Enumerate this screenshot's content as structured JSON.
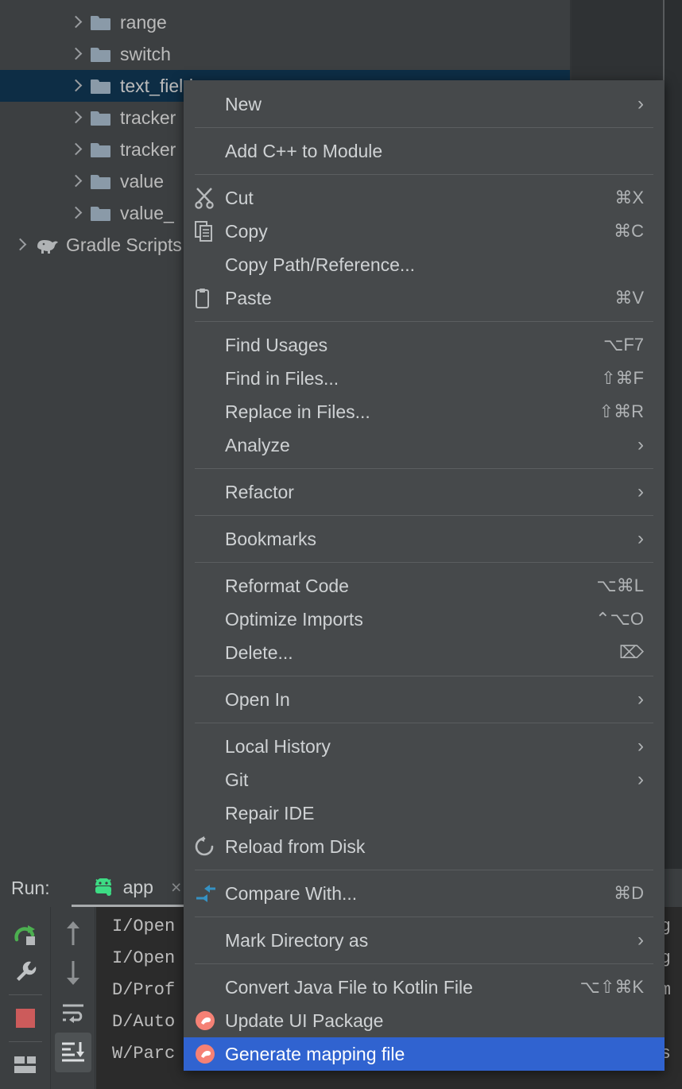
{
  "app": {
    "theme_bg": "#3c3f41",
    "menu_bg": "#46494b",
    "accent_blue": "#3063d0",
    "tree_selection": "#0d2d45",
    "text_color": "#cfd2d4"
  },
  "project_tree": {
    "items": [
      {
        "label": "range",
        "icon": "folder-icon",
        "expander": "chevron-right-icon",
        "selected": false
      },
      {
        "label": "switch",
        "icon": "folder-icon",
        "expander": "chevron-right-icon",
        "selected": false
      },
      {
        "label": "text_field",
        "icon": "folder-icon",
        "expander": "chevron-right-icon",
        "selected": true
      },
      {
        "label": "tracker",
        "icon": "folder-icon",
        "expander": "chevron-right-icon",
        "selected": false
      },
      {
        "label": "tracker",
        "icon": "folder-icon",
        "expander": "chevron-right-icon",
        "selected": false
      },
      {
        "label": "value",
        "icon": "folder-icon",
        "expander": "chevron-right-icon",
        "selected": false
      },
      {
        "label": "value_",
        "icon": "folder-icon",
        "expander": "chevron-right-icon",
        "selected": false
      },
      {
        "label": "Gradle Scripts",
        "icon": "gradle-elephant-icon",
        "expander": "chevron-right-icon",
        "selected": false
      }
    ]
  },
  "context_menu": {
    "selected_item": "Generate mapping file",
    "groups": [
      {
        "items": [
          {
            "label": "New",
            "icon": null,
            "accel": "",
            "submenu": true
          }
        ]
      },
      {
        "items": [
          {
            "label": "Add C++ to Module",
            "icon": null,
            "accel": "",
            "submenu": false
          }
        ]
      },
      {
        "items": [
          {
            "label": "Cut",
            "icon": "scissors-icon",
            "accel": "⌘X",
            "submenu": false
          },
          {
            "label": "Copy",
            "icon": "copy-icon",
            "accel": "⌘C",
            "submenu": false
          },
          {
            "label": "Copy Path/Reference...",
            "icon": null,
            "accel": "",
            "submenu": false
          },
          {
            "label": "Paste",
            "icon": "clipboard-icon",
            "accel": "⌘V",
            "submenu": false
          }
        ]
      },
      {
        "items": [
          {
            "label": "Find Usages",
            "icon": null,
            "accel": "⌥F7",
            "submenu": false
          },
          {
            "label": "Find in Files...",
            "icon": null,
            "accel": "⇧⌘F",
            "submenu": false
          },
          {
            "label": "Replace in Files...",
            "icon": null,
            "accel": "⇧⌘R",
            "submenu": false
          },
          {
            "label": "Analyze",
            "icon": null,
            "accel": "",
            "submenu": true
          }
        ]
      },
      {
        "items": [
          {
            "label": "Refactor",
            "icon": null,
            "accel": "",
            "submenu": true
          }
        ]
      },
      {
        "items": [
          {
            "label": "Bookmarks",
            "icon": null,
            "accel": "",
            "submenu": true
          }
        ]
      },
      {
        "items": [
          {
            "label": "Reformat Code",
            "icon": null,
            "accel": "⌥⌘L",
            "submenu": false
          },
          {
            "label": "Optimize Imports",
            "icon": null,
            "accel": "⌃⌥O",
            "submenu": false
          },
          {
            "label": "Delete...",
            "icon": null,
            "accel": "⌦",
            "submenu": false
          }
        ]
      },
      {
        "items": [
          {
            "label": "Open In",
            "icon": null,
            "accel": "",
            "submenu": true
          }
        ]
      },
      {
        "items": [
          {
            "label": "Local History",
            "icon": null,
            "accel": "",
            "submenu": true
          },
          {
            "label": "Git",
            "icon": null,
            "accel": "",
            "submenu": true
          },
          {
            "label": "Repair IDE",
            "icon": null,
            "accel": "",
            "submenu": false
          },
          {
            "label": "Reload from Disk",
            "icon": "refresh-icon",
            "accel": "",
            "submenu": false
          }
        ]
      },
      {
        "items": [
          {
            "label": "Compare With...",
            "icon": "compare-icon",
            "accel": "⌘D",
            "submenu": false
          }
        ]
      },
      {
        "items": [
          {
            "label": "Mark Directory as",
            "icon": null,
            "accel": "",
            "submenu": true
          }
        ]
      },
      {
        "items": [
          {
            "label": "Convert Java File to Kotlin File",
            "icon": null,
            "accel": "⌥⇧⌘K",
            "submenu": false
          },
          {
            "label": "Update UI Package",
            "icon": "plugin-icon",
            "accel": "",
            "submenu": false
          },
          {
            "label": "Generate mapping file",
            "icon": "plugin-icon",
            "accel": "",
            "submenu": false,
            "selected": true
          }
        ]
      }
    ]
  },
  "run_panel": {
    "title": "Run:",
    "tab_label": "app",
    "tab_icon": "android-robot-icon",
    "tab_close": "×",
    "toolbar_left": [
      {
        "name": "rerun-icon",
        "title": "Rerun"
      },
      {
        "name": "settings-wrench-icon",
        "title": "Edit Configuration"
      },
      {
        "name": "stop-icon",
        "title": "Stop"
      },
      {
        "name": "layout-icon",
        "title": "Layout Inspector"
      }
    ],
    "toolbar_mid": [
      {
        "name": "arrow-up-icon",
        "title": "Up"
      },
      {
        "name": "arrow-down-icon",
        "title": "Down"
      },
      {
        "name": "soft-wrap-icon",
        "title": "Soft-Wrap"
      },
      {
        "name": "scroll-to-end-icon",
        "title": "Scroll to End",
        "active": true
      }
    ],
    "log_lines": [
      {
        "text": "I/Open",
        "tail": "g"
      },
      {
        "text": "I/Open",
        "tail": "g"
      },
      {
        "text": "D/Prof",
        "tail": "m"
      },
      {
        "text": "D/Auto",
        "tail": ""
      },
      {
        "text": "W/Parc",
        "tail": ".s"
      }
    ]
  }
}
